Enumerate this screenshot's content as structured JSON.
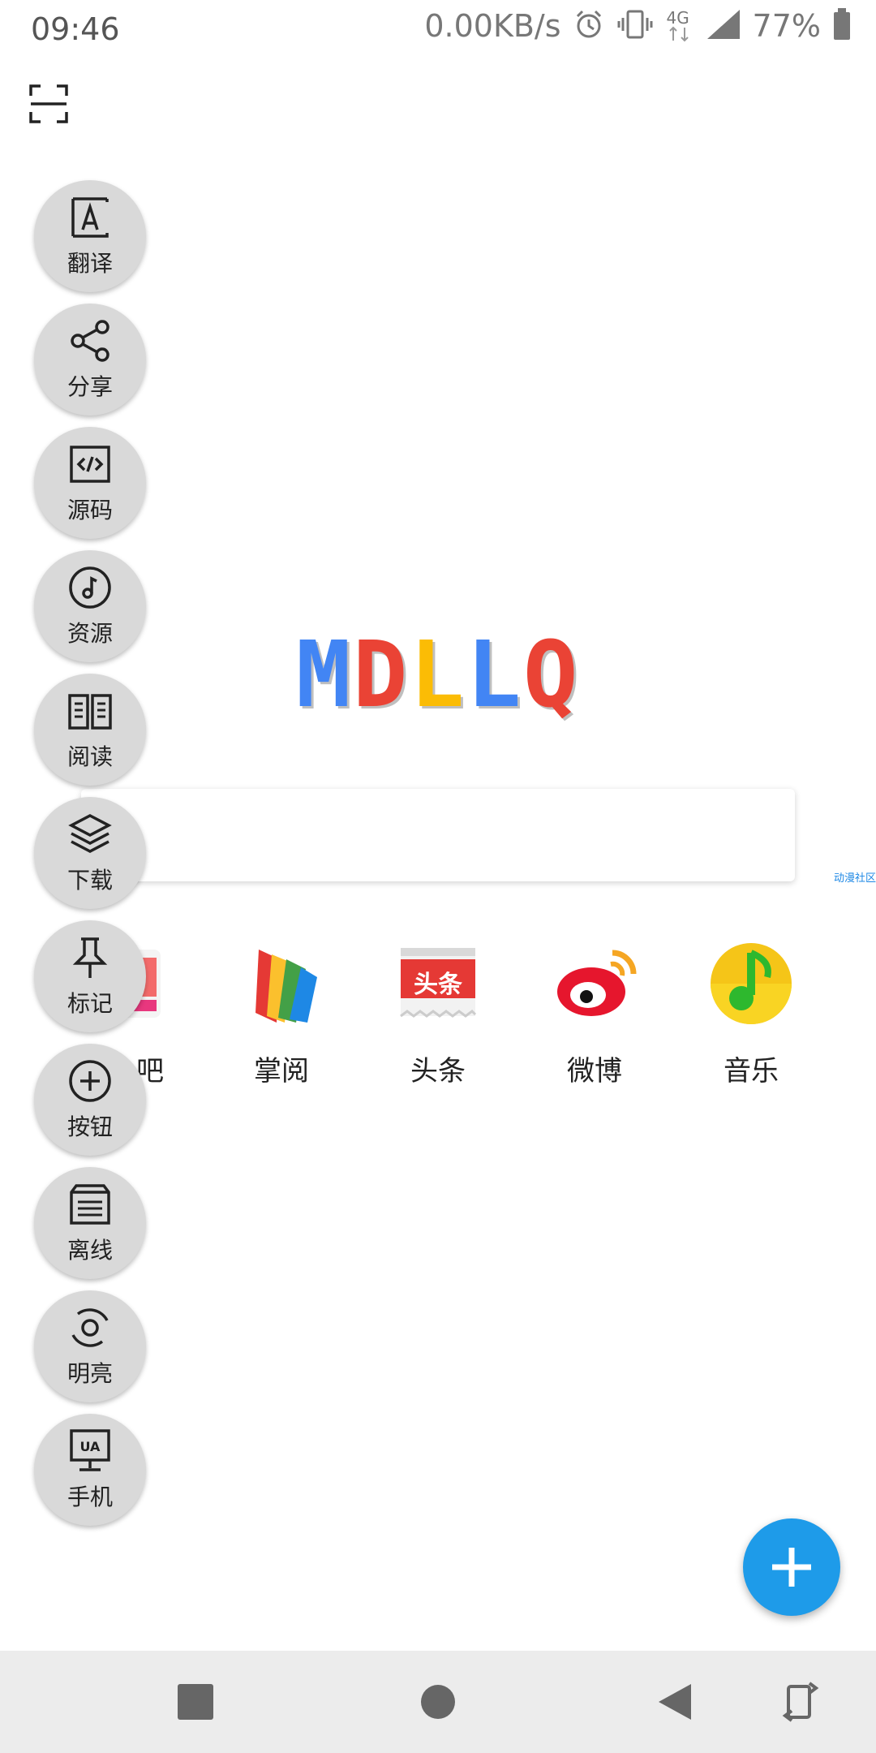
{
  "status_bar": {
    "time": "09:46",
    "net_speed": "0.00KB/s",
    "network": "4G",
    "battery": "77%"
  },
  "logo": {
    "letters": [
      "M",
      "D",
      "L",
      "L",
      "Q"
    ],
    "colors": [
      "#4285f4",
      "#ea4335",
      "#fbbc05",
      "#4285f4",
      "#ea4335"
    ]
  },
  "search": {
    "placeholder": ""
  },
  "side_link": "动漫社区",
  "side_menu": [
    {
      "label": "翻译",
      "icon": "translate-icon"
    },
    {
      "label": "分享",
      "icon": "share-icon"
    },
    {
      "label": "源码",
      "icon": "source-code-icon"
    },
    {
      "label": "资源",
      "icon": "music-resource-icon"
    },
    {
      "label": "阅读",
      "icon": "book-icon"
    },
    {
      "label": "下载",
      "icon": "layers-icon"
    },
    {
      "label": "标记",
      "icon": "pin-icon"
    },
    {
      "label": "按钮",
      "icon": "plus-circle-icon"
    },
    {
      "label": "离线",
      "icon": "offline-icon"
    },
    {
      "label": "明亮",
      "icon": "brightness-icon"
    },
    {
      "label": "手机",
      "icon": "ua-monitor-icon"
    }
  ],
  "quick_apps": [
    {
      "label": "吧",
      "icon": "tieba-icon"
    },
    {
      "label": "掌阅",
      "icon": "zhangyue-icon"
    },
    {
      "label": "头条",
      "icon": "toutiao-icon",
      "icon_text": "头条"
    },
    {
      "label": "微博",
      "icon": "weibo-icon"
    },
    {
      "label": "音乐",
      "icon": "qq-music-icon"
    }
  ],
  "accent_color": "#1e9be9"
}
